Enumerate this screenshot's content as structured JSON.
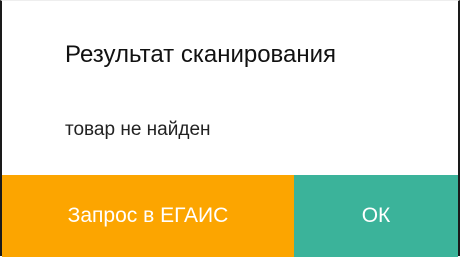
{
  "dialog": {
    "title": "Результат сканирования",
    "message": "товар не найден",
    "buttons": {
      "egais_label": "Запрос в ЕГАИС",
      "ok_label": "ОК"
    }
  },
  "colors": {
    "egais_button": "#fca500",
    "ok_button": "#3bb39a",
    "background": "#ffffff",
    "text": "#111111"
  }
}
